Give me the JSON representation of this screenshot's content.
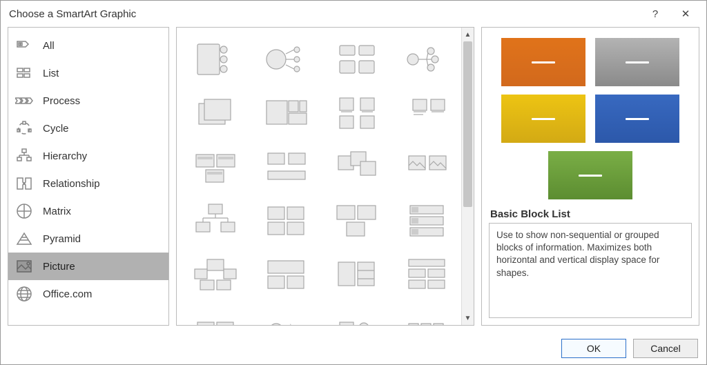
{
  "title": "Choose a SmartArt Graphic",
  "categories": [
    {
      "icon": "all",
      "label": "All"
    },
    {
      "icon": "list",
      "label": "List"
    },
    {
      "icon": "process",
      "label": "Process"
    },
    {
      "icon": "cycle",
      "label": "Cycle"
    },
    {
      "icon": "hierarchy",
      "label": "Hierarchy"
    },
    {
      "icon": "relationship",
      "label": "Relationship"
    },
    {
      "icon": "matrix",
      "label": "Matrix"
    },
    {
      "icon": "pyramid",
      "label": "Pyramid"
    },
    {
      "icon": "picture",
      "label": "Picture",
      "selected": true
    },
    {
      "icon": "office",
      "label": "Office.com"
    }
  ],
  "preview": {
    "title": "Basic Block List",
    "description": "Use to show non-sequential or grouped blocks of information. Maximizes both horizontal and vertical display space for shapes.",
    "blocks": [
      "orange",
      "gray",
      "yellow",
      "blue",
      "green"
    ]
  },
  "buttons": {
    "ok": "OK",
    "cancel": "Cancel"
  },
  "helpGlyph": "?",
  "closeGlyph": "✕"
}
